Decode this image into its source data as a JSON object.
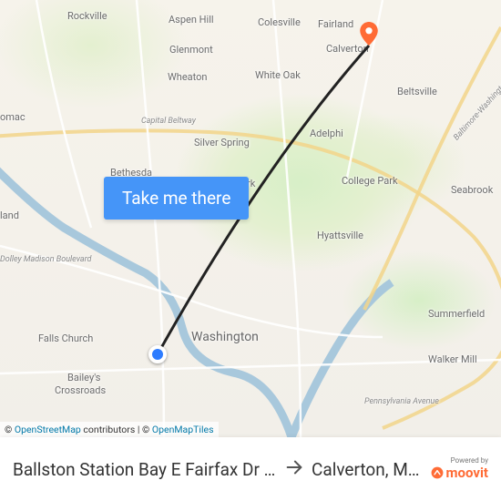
{
  "cta_label": "Take me there",
  "attribution": {
    "prefix": "© ",
    "link1_text": "OpenStreetMap",
    "mid": " contributors | © ",
    "link2_text": "OpenMapTiles"
  },
  "route": {
    "from": "Ballston Station Bay E Fairfax Dr E…",
    "to": "Calverton, M…"
  },
  "moovit": {
    "poweredby": "Powered by",
    "name": "moovit"
  },
  "places": {
    "rockville": "Rockville",
    "aspen_hill": "Aspen Hill",
    "colesville": "Colesville",
    "fairland": "Fairland",
    "glenmont": "Glenmont",
    "calverton": "Calverton",
    "wheaton": "Wheaton",
    "white_oak": "White Oak",
    "beltsville": "Beltsville",
    "potomac": "omac",
    "silver_spring": "Silver Spring",
    "adelphi": "Adelphi",
    "bethesda": "Bethesda",
    "takoma_park": "Takoma Park",
    "college_park": "College Park",
    "seabrook": "Seabrook",
    "land": "land",
    "hyattsville": "Hyattsville",
    "washington": "Washington",
    "summerfield": "Summerfield",
    "falls_church": "Falls Church",
    "walker_mill": "Walker Mill",
    "baileys": "Bailey's",
    "crossroads": "Crossroads"
  },
  "roads": {
    "capital_beltway": "Capital Beltway",
    "dolley_madison": "Dolley Madison Boulevard",
    "pennsylvania": "Pennsylvania Avenue",
    "bw_parkway": "Baltimore-Washington Parkway"
  },
  "colors": {
    "cta_bg": "#4595f8",
    "origin_marker": "#2d7cff",
    "dest_marker": "#ff6b35",
    "moovit": "#ff6b35"
  }
}
